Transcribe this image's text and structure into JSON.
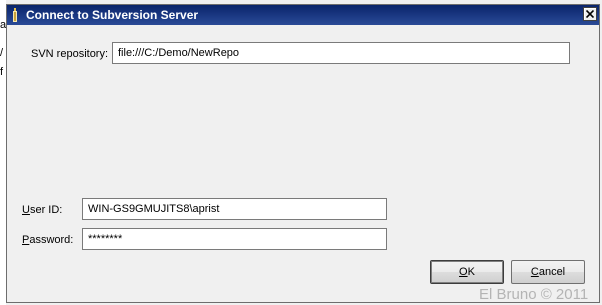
{
  "background": {
    "glyphs": [
      "a",
      "/",
      "f"
    ]
  },
  "dialog": {
    "title": "Connect to Subversion Server",
    "title_icon": "app-icon",
    "close_icon": "close-icon",
    "repository": {
      "label": "SVN repository:",
      "value": "file:///C:/Demo/NewRepo"
    },
    "user_id": {
      "label_mnemonic": "U",
      "label_rest": "ser ID:",
      "value": "WIN-GS9GMUJITS8\\aprist"
    },
    "password": {
      "label_mnemonic": "P",
      "label_rest": "assword:",
      "value": "********"
    },
    "buttons": {
      "ok_mnemonic": "O",
      "ok_rest": "K",
      "cancel_mnemonic": "C",
      "cancel_rest": "ancel"
    }
  },
  "watermark": "El Bruno © 2011",
  "colors": {
    "titlebar": "#0a246a",
    "dialog_bg": "#f0f0f0",
    "watermark": "#b4b4b4"
  }
}
